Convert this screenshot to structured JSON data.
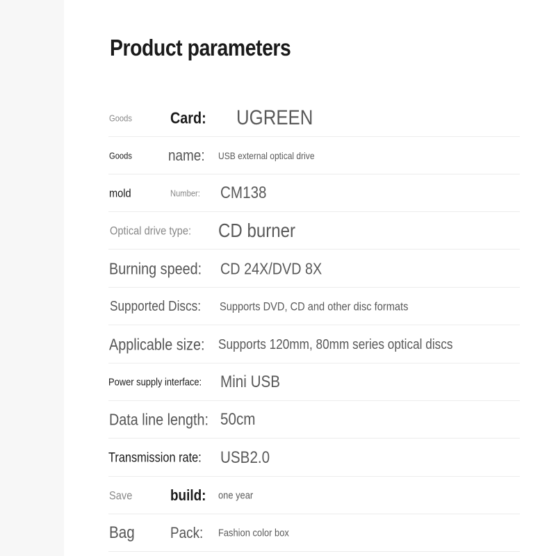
{
  "title": "Product parameters",
  "rows": [
    {
      "a": "Goods",
      "b": "Card:",
      "value": "UGREEN"
    },
    {
      "a": "Goods",
      "b": "name:",
      "value": "USB external optical drive"
    },
    {
      "a": "mold",
      "b": "Number:",
      "value": "CM138"
    },
    {
      "a": "Optical drive type:",
      "value": "CD burner"
    },
    {
      "a": "Burning speed:",
      "value": "CD 24X/DVD 8X"
    },
    {
      "a": "Supported Discs:",
      "value": "Supports DVD, CD and other disc formats"
    },
    {
      "a": "Applicable size:",
      "value": "Supports 120mm, 80mm series optical discs"
    },
    {
      "a": "Power supply interface:",
      "value": "Mini USB"
    },
    {
      "a": "Data line length:",
      "value": "50cm"
    },
    {
      "a": "Transmission rate:",
      "value": "USB2.0"
    },
    {
      "a": "Save",
      "b": "build:",
      "value": "one year"
    },
    {
      "a": "Bag",
      "b": "Pack:",
      "value": "Fashion color box"
    }
  ]
}
